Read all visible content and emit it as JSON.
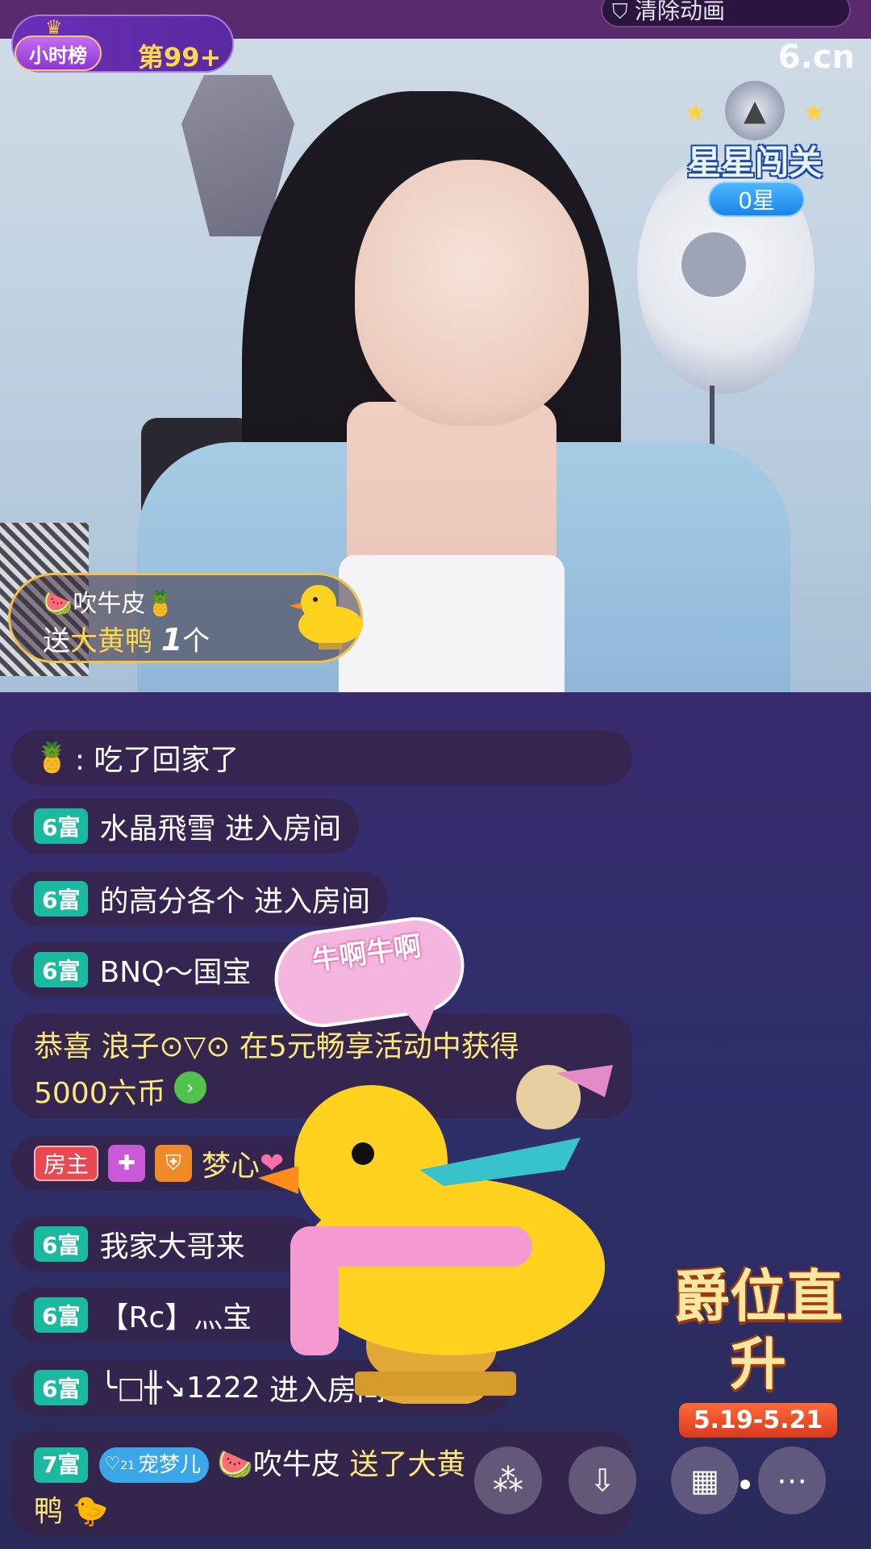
{
  "top": {
    "pill_text": "清除动画"
  },
  "rank": {
    "badge": "小时榜",
    "value": "第99+"
  },
  "watermark": "6.cn",
  "star_challenge": {
    "title": "星星闯关",
    "count": "0星"
  },
  "gift_notice": {
    "user": "吹牛皮",
    "send": "送",
    "gift": "大黄鸭",
    "qty": "1",
    "unit": "个"
  },
  "chat": [
    {
      "type": "msg",
      "text": ": 吃了回家了"
    },
    {
      "type": "enter",
      "level": "6富",
      "user": "水晶飛雪",
      "action": "进入房间"
    },
    {
      "type": "enter",
      "level": "6富",
      "user": "的高分各个",
      "action": "进入房间"
    },
    {
      "type": "enter",
      "level": "6富",
      "user": "BNQ～国宝",
      "action": ""
    },
    {
      "type": "event",
      "text": "恭喜 浪子⊙▽⊙ 在5元畅享活动中获得",
      "reward": "5000六币"
    },
    {
      "type": "host",
      "badge": "房主",
      "user": "梦心"
    },
    {
      "type": "enter",
      "level": "6富",
      "user": "我家大哥来",
      "action": ""
    },
    {
      "type": "enter",
      "level": "6富",
      "user": "【Rc】灬宝",
      "action": ""
    },
    {
      "type": "enter",
      "level": "6富",
      "user": "╰□╫↘1222",
      "action": "进入房间"
    },
    {
      "type": "gift",
      "level": "7富",
      "fan_badge": "宠梦儿",
      "fan_level": "21",
      "user": "吹牛皮",
      "action": "送了大黄",
      "tail": "鸭"
    }
  ],
  "bubble": {
    "text": "牛啊牛啊"
  },
  "promo": {
    "title": "爵位直升",
    "dates": "5.19-5.21"
  },
  "colors": {
    "accent": "#ffd84d",
    "rich_badge": "#1bbaa0",
    "host_badge": "#e84a54",
    "promo_date": "#d83a1c"
  }
}
